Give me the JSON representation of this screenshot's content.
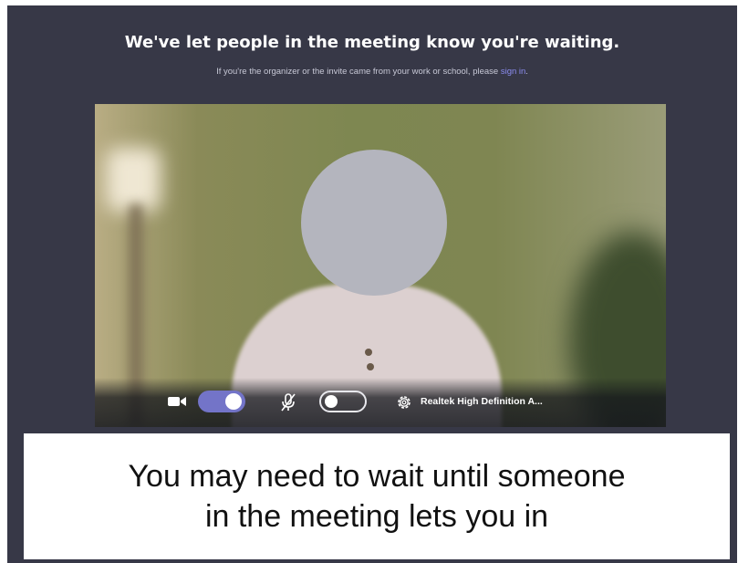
{
  "lobby": {
    "headline": "We've let people in the meeting know you're waiting.",
    "subline_prefix": "If you're the organizer or the invite came from your work or school, please ",
    "sign_in_link": "sign in",
    "subline_suffix": "."
  },
  "preview": {
    "camera_icon": "video-camera-icon",
    "camera_on": true,
    "mic_icon": "microphone-muted-icon",
    "mic_on": false,
    "settings_icon": "gear-icon",
    "audio_device": "Realtek High Definition A..."
  },
  "caption": {
    "line1": "You may need to wait until someone",
    "line2": "in the meeting lets you in"
  },
  "colors": {
    "background": "#373847",
    "accent": "#7374c8",
    "link": "#8b8cf0"
  }
}
